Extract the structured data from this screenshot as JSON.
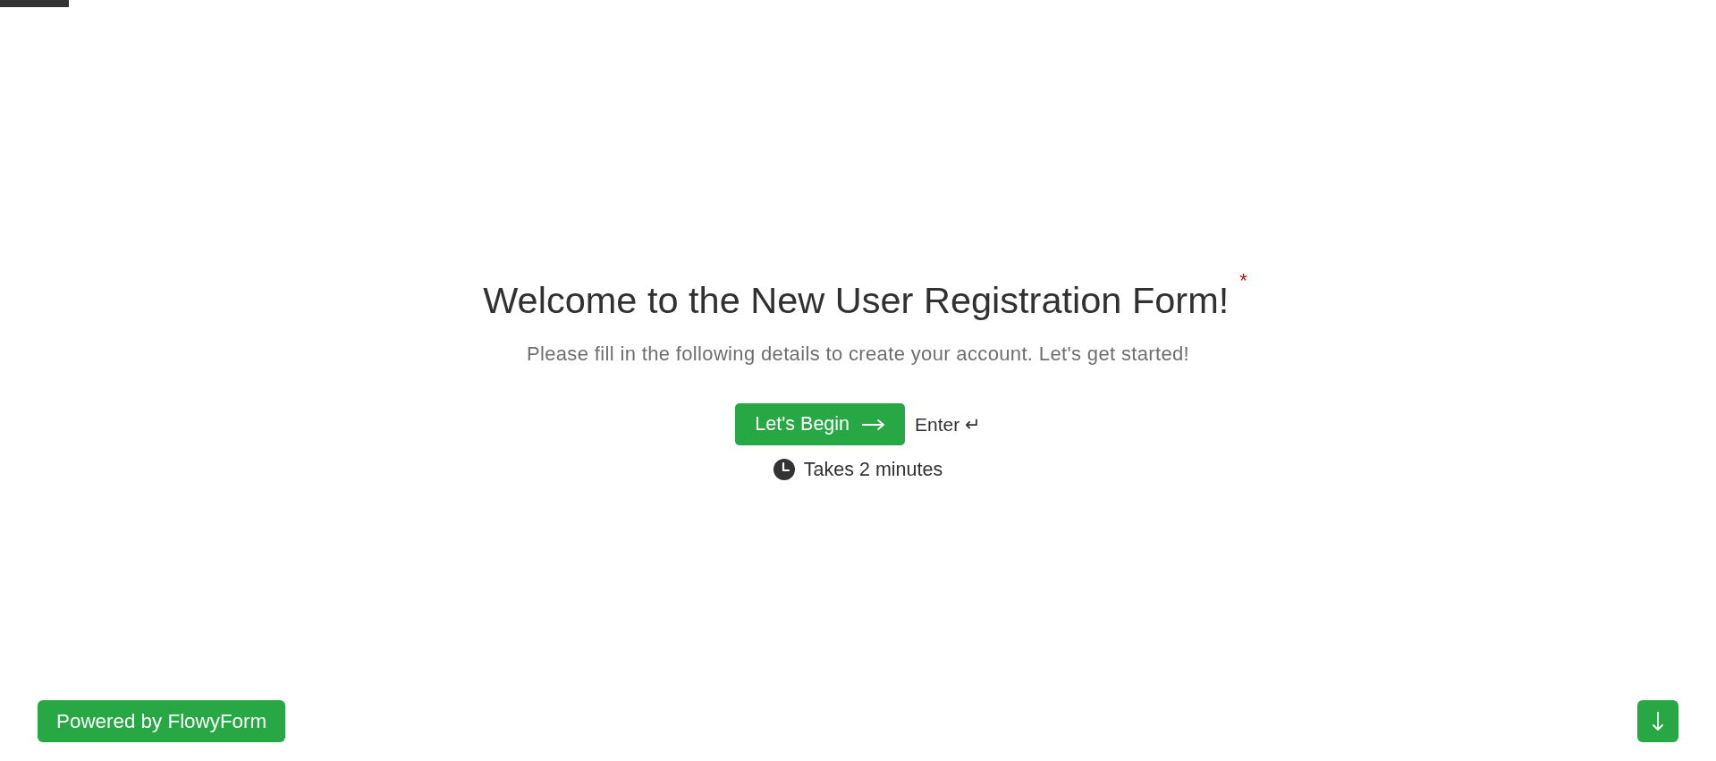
{
  "progress": {
    "level": 0.04
  },
  "heading": {
    "title": "Welcome to the New User Registration Form!",
    "required_mark": "*"
  },
  "subtitle": "Please fill in the following details to create your account. Let's get started!",
  "start_button": {
    "label": "Let's Begin"
  },
  "key_hint": "Enter ↵",
  "duration": "Takes 2 minutes",
  "footer": {
    "badge": "Powered by FlowyForm"
  }
}
